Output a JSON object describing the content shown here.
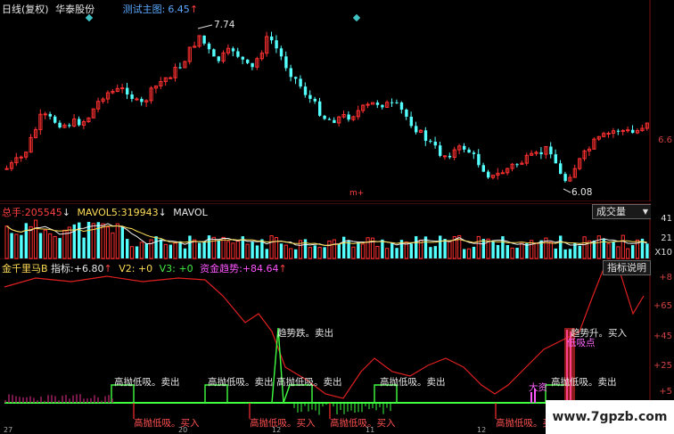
{
  "price_pane": {
    "header": {
      "period": "日线(复权)",
      "stock_name": "华泰股份",
      "indicator": "测试主图:",
      "indicator_value": "6.45",
      "arrow": "↑"
    },
    "high_label": "7.74",
    "low_label": "6.08",
    "right_axis_label": "6.6",
    "marker_text": "m+"
  },
  "volume_pane": {
    "header": {
      "total_label": "总手:",
      "total_value": "205545",
      "total_arrow": "↓",
      "mavol5_label": "MAVOL5:",
      "mavol5_value": "319943",
      "mavol5_arrow": "↓",
      "mavol_label": "MAVOL"
    },
    "selector": "成交量",
    "selector_arrow": "▼",
    "axis_labels": [
      "41",
      "21",
      "X10"
    ]
  },
  "indicator_pane": {
    "header": {
      "name": "金千里马B",
      "label": "指标:",
      "value": "+6.80",
      "arrow1": "↑",
      "v2": "V2: +0",
      "v3": "V3: +0",
      "fund_label": "资金趋势:",
      "fund_value": "+84.64",
      "arrow2": "↑"
    },
    "help_button": "指标说明",
    "axis_labels": [
      "+8",
      "+65",
      "+45",
      "+25",
      "+5"
    ],
    "annotations": {
      "sell_gaodi": "高抛低吸。卖出",
      "buy_gaodi": "高抛低吸。买入",
      "trend_down_sell": "趋势跌。卖出",
      "trend_up_buy": "趋势升。买入",
      "big_fund": "大资",
      "low_point": "低吸点"
    },
    "bottom_axis": [
      "27",
      "20",
      "12",
      "11",
      "12"
    ]
  },
  "watermark": "www.7gpzb.com",
  "colors": {
    "up": "#ff3030",
    "down": "#54ffff",
    "line_red": "#e02020",
    "signal_green": "#40ff40",
    "grid": "#7a1010"
  }
}
